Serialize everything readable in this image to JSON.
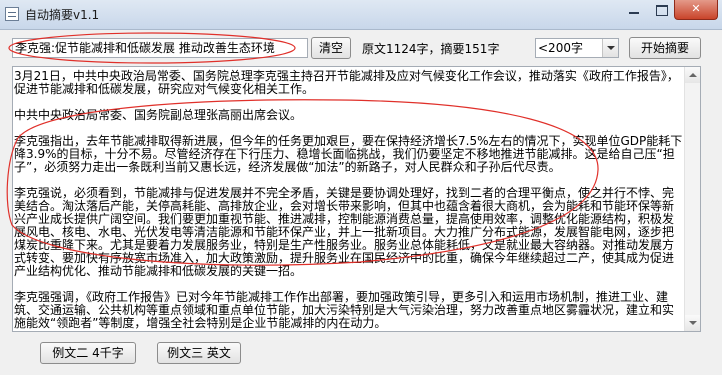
{
  "window": {
    "title": "自动摘要v1.1",
    "close_glyph": "✕"
  },
  "toolbar": {
    "input_value": "李克强:促节能减排和低碳发展 推动改善生态环境",
    "clear_label": "清空",
    "stats_text": "原文1124字，摘要151字",
    "length_value": "<200字",
    "start_label": "开始摘要"
  },
  "summary": {
    "paragraphs": [
      "3月21日，中共中央政治局常委、国务院总理李克强主持召开节能减排及应对气候变化工作会议，推动落实《政府工作报告》，促进节能减排和低碳发展，研究应对气候变化相关工作。",
      "中共中央政治局常委、国务院副总理张高丽出席会议。",
      "李克强指出，去年节能减排取得新进展，但今年的任务更加艰巨，要在保持经济增长7.5%左右的情况下，实现单位GDP能耗下降3.9%的目标，十分不易。尽管经济存在下行压力、稳增长面临挑战，我们仍要坚定不移地推进节能减排。这是给自己压“担子”，必须努力走出一条既利当前又惠长远，经济发展做“加法”的新路子，对人民群众和子孙后代尽责。",
      "李克强说，必须看到，节能减排与促进发展并不完全矛盾，关键是要协调处理好，找到二者的合理平衡点，使之并行不悖、完美结合。淘汰落后产能，关停高耗能、高排放企业，会对增长带来影响，但其中也蕴含着很大商机，会为能耗和节能环保等新兴产业成长提供广阔空间。我们要更加重视节能、推进减排，控制能源消费总量，提高使用效率，调整优化能源结构，积极发展风电、核电、水电、光伏发电等清洁能源和节能环保产业，并上一批新项目。大力推广分布式能源，发展智能电网，逐步把煤炭比重降下来。尤其是要着力发展服务业，特别是生产性服务业。服务业总体能耗低，又是就业最大容纳器。对推动发展方式转变、要加快有序放宽市场准入，加大政策激励，提升服务业在国民经济中的比重，确保今年继续超过二产，使其成为促进产业结构优化、推动节能减排和低碳发展的关键一招。",
      "李克强强调，《政府工作报告》已对今年节能减排工作作出部署，要加强政策引导，更多引入和运用市场机制，推进工业、建筑、交通运输、公共机构等重点领域和重点单位节能，加大污染特别是大气污染治理，努力改善重点地区雾霾状况，建立和实施能效“领跑者”等制度，增强全社会特别是企业节能减排的内在动力。"
    ]
  },
  "examples": {
    "ex2_label": "例文二 4千字",
    "ex3_label": "例文三 英文"
  },
  "annotation_color": "#e0302a"
}
